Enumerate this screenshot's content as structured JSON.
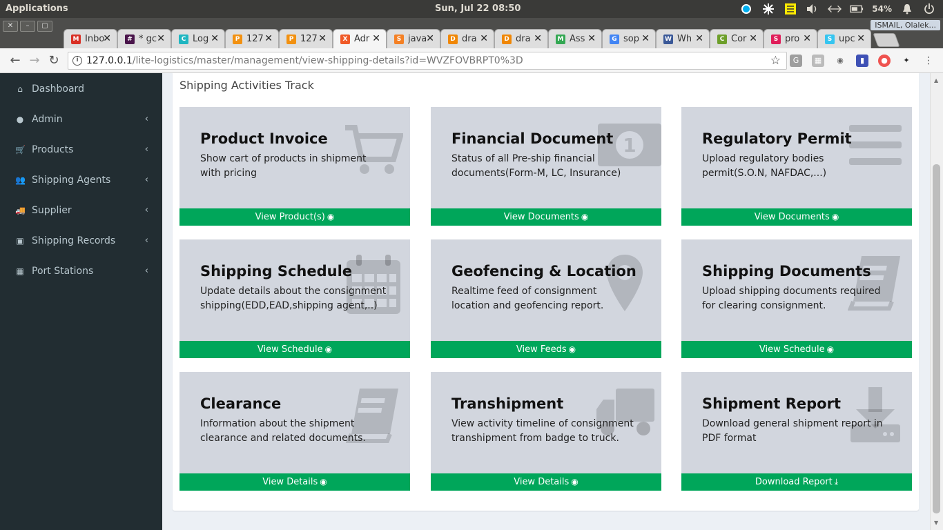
{
  "os": {
    "apps_label": "Applications",
    "clock": "Sun, Jul 22    08:50",
    "battery": "54%",
    "tray_icons": [
      "skype-icon",
      "network-icon",
      "notes-icon",
      "volume-icon",
      "arrows-icon",
      "battery-icon",
      "bell-icon",
      "power-icon"
    ]
  },
  "browser": {
    "profile": "ISMAIL, Olalek...",
    "tabs": [
      {
        "title": "Inbo",
        "favicon_color": "#d93025",
        "favicon_glyph": "M"
      },
      {
        "title": "* gc",
        "favicon_color": "#4a154b",
        "favicon_glyph": "#"
      },
      {
        "title": "Log",
        "favicon_color": "#1fb6c1",
        "favicon_glyph": "C"
      },
      {
        "title": "127",
        "favicon_color": "#f29111",
        "favicon_glyph": "P"
      },
      {
        "title": "127",
        "favicon_color": "#f29111",
        "favicon_glyph": "P"
      },
      {
        "title": "Adr",
        "favicon_color": "#f05a28",
        "favicon_glyph": "X"
      },
      {
        "title": "java",
        "favicon_color": "#f48024",
        "favicon_glyph": "S"
      },
      {
        "title": "dra",
        "favicon_color": "#f08705",
        "favicon_glyph": "D"
      },
      {
        "title": "dra",
        "favicon_color": "#f08705",
        "favicon_glyph": "D"
      },
      {
        "title": "Ass",
        "favicon_color": "#34a853",
        "favicon_glyph": "M"
      },
      {
        "title": "sop",
        "favicon_color": "#4285f4",
        "favicon_glyph": "G"
      },
      {
        "title": "Wh",
        "favicon_color": "#3b5998",
        "favicon_glyph": "W"
      },
      {
        "title": "Cor",
        "favicon_color": "#6d9f2a",
        "favicon_glyph": "C"
      },
      {
        "title": "pro",
        "favicon_color": "#e01e5a",
        "favicon_glyph": "S"
      },
      {
        "title": "upc",
        "favicon_color": "#36c5f0",
        "favicon_glyph": "S"
      }
    ],
    "url_host": "127.0.0.1",
    "url_path": "/lite-logistics/master/management/view-shipping-details?id=WVZFOVBRPT0%3D"
  },
  "sidebar": {
    "items": [
      {
        "label": "Dashboard",
        "icon": "dashboard-icon",
        "glyph": "⌂",
        "has_chevron": false
      },
      {
        "label": "Admin",
        "icon": "user-icon",
        "glyph": "●",
        "has_chevron": true
      },
      {
        "label": "Products",
        "icon": "cart-icon",
        "glyph": "🛒",
        "has_chevron": true
      },
      {
        "label": "Shipping Agents",
        "icon": "users-icon",
        "glyph": "👥",
        "has_chevron": true
      },
      {
        "label": "Supplier",
        "icon": "truck-icon",
        "glyph": "🚚",
        "has_chevron": true
      },
      {
        "label": "Shipping Records",
        "icon": "money-icon",
        "glyph": "▣",
        "has_chevron": true
      },
      {
        "label": "Port Stations",
        "icon": "building-icon",
        "glyph": "▦",
        "has_chevron": true
      }
    ]
  },
  "main": {
    "title": "Shipping Activities Track",
    "cards": [
      {
        "heading": "Product Invoice",
        "desc": "Show cart of products in shipment with pricing",
        "footer": "View Product(s)",
        "footer_icon": "eye-icon",
        "icon": "cart-icon"
      },
      {
        "heading": "Financial Document",
        "desc": "Status of all Pre-ship financial documents(Form-M, LC, Insurance)",
        "footer": "View Documents",
        "footer_icon": "eye-icon",
        "icon": "money-icon"
      },
      {
        "heading": "Regulatory Permit",
        "desc": "Upload regulatory bodies permit(S.O.N, NAFDAC,...)",
        "footer": "View Documents",
        "footer_icon": "eye-icon",
        "icon": "list-icon"
      },
      {
        "heading": "Shipping Schedule",
        "desc": "Update details about the consignment shipping(EDD,EAD,shipping agent,..)",
        "footer": "View Schedule",
        "footer_icon": "eye-icon",
        "icon": "calendar-icon"
      },
      {
        "heading": "Geofencing & Location",
        "desc": "Realtime feed of consignment location and geofencing report.",
        "footer": "View Feeds",
        "footer_icon": "eye-icon",
        "icon": "map-marker-icon"
      },
      {
        "heading": "Shipping Documents",
        "desc": "Upload shipping documents required for clearing consignment.",
        "footer": "View Schedule",
        "footer_icon": "eye-icon",
        "icon": "book-icon"
      },
      {
        "heading": "Clearance",
        "desc": "Information about the shipment clearance and related documents.",
        "footer": "View Details",
        "footer_icon": "eye-icon",
        "icon": "book-icon"
      },
      {
        "heading": "Transhipment",
        "desc": "View activity timeline of consignment transhipment from badge to truck.",
        "footer": "View Details",
        "footer_icon": "eye-icon",
        "icon": "truck-icon"
      },
      {
        "heading": "Shipment Report",
        "desc": "Download general shipment report in PDF format",
        "footer": "Download Report",
        "footer_icon": "download-icon",
        "icon": "download-icon"
      }
    ]
  },
  "colors": {
    "sidebar_bg": "#222d32",
    "card_bg": "#d2d6de",
    "footer_green": "#00a65a"
  }
}
